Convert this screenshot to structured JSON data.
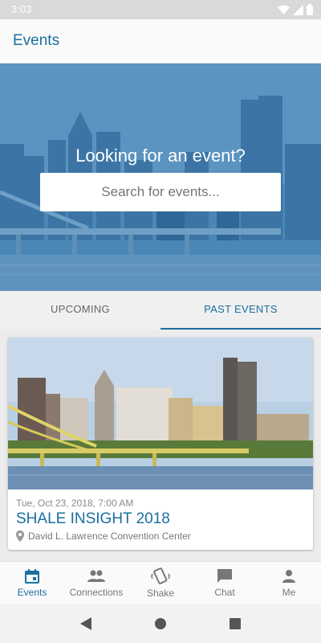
{
  "status_bar": {
    "time": "3:03"
  },
  "app_bar": {
    "title": "Events"
  },
  "hero": {
    "heading": "Looking for an event?",
    "search_placeholder": "Search for events..."
  },
  "tabs": [
    {
      "label": "UPCOMING",
      "active": false
    },
    {
      "label": "PAST EVENTS",
      "active": true
    }
  ],
  "event_card": {
    "date": "Tue, Oct 23, 2018, 7:00 AM",
    "title": "SHALE INSIGHT 2018",
    "location": "David L. Lawrence Convention Center"
  },
  "bottom_nav": [
    {
      "label": "Events",
      "icon": "calendar-icon",
      "active": true
    },
    {
      "label": "Connections",
      "icon": "people-icon",
      "active": false
    },
    {
      "label": "Shake",
      "icon": "shake-phone-icon",
      "active": false
    },
    {
      "label": "Chat",
      "icon": "chat-bubble-icon",
      "active": false
    },
    {
      "label": "Me",
      "icon": "person-icon",
      "active": false
    }
  ],
  "colors": {
    "accent": "#1a6fa0",
    "hero_tint": "#3f7fb0"
  }
}
